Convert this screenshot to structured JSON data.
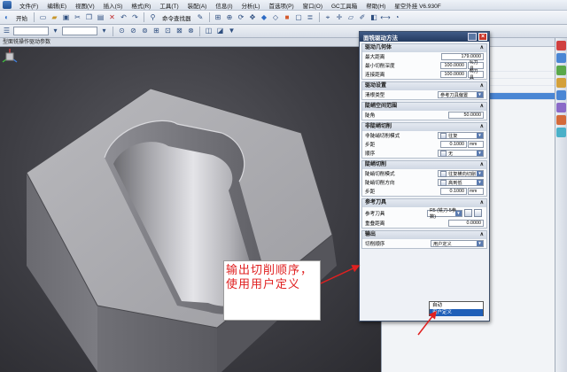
{
  "menubar": {
    "items": [
      "文件(F)",
      "编辑(E)",
      "视图(V)",
      "插入(S)",
      "格式(R)",
      "工具(T)",
      "装配(A)",
      "信息(I)",
      "分析(L)",
      "首选项(P)",
      "窗口(O)",
      "GC工具箱",
      "帮助(H)",
      "星空外挂 V6.930F"
    ]
  },
  "toolbar": {
    "start_label": "开始",
    "command_finder": "命令查找器"
  },
  "viewport": {
    "caption": "型面铣操作驱动参数"
  },
  "dialog": {
    "title": "面铣驱动方法",
    "sections": {
      "drive_geometry": {
        "title": "驱动几何体",
        "rows": [
          {
            "label": "最大距离",
            "value": "179.0000",
            "unit": ""
          },
          {
            "label": "最小切削深度",
            "value": "100.0000",
            "unit": "%刀具"
          },
          {
            "label": "连接距离",
            "value": "100.0000",
            "unit": "%刀具"
          }
        ]
      },
      "drive_settings": {
        "title": "驱动设置",
        "rows": [
          {
            "label": "清根类型",
            "value": "参考刀具偏置"
          }
        ]
      },
      "steep_space": {
        "title": "陡峭空间范围",
        "rows": [
          {
            "label": "陡角",
            "value": "50.0000"
          }
        ]
      },
      "non_steep": {
        "title": "非陡峭切削",
        "rows": [
          {
            "label": "非陡峭切削模式",
            "value": "往复"
          },
          {
            "label": "步距",
            "value": "0.1000",
            "unit": "mm"
          },
          {
            "label": "顺序",
            "value": "无"
          }
        ]
      },
      "steep": {
        "title": "陡峭切削",
        "rows": [
          {
            "label": "陡峭切削模式",
            "value": "往复横向切削"
          },
          {
            "label": "陡峭切削方向",
            "value": "高到低"
          },
          {
            "label": "步距",
            "value": "0.1000",
            "unit": "mm"
          }
        ]
      },
      "ref_tool": {
        "title": "参考刀具",
        "rows": [
          {
            "label": "参考刀具",
            "value": "R5 (铣刀-5参数)"
          },
          {
            "label": "重叠距离",
            "value": "0.0000"
          }
        ]
      },
      "output": {
        "title": "输出",
        "rows": [
          {
            "label": "切削顺序",
            "value": "用户定义"
          }
        ]
      }
    },
    "dropdown_options": [
      "自动",
      "用户定义"
    ]
  },
  "annotation": {
    "text": "输出切削顺序，使用用户定义"
  },
  "colors": {
    "dialog_title": "#2d4670",
    "annotation_text": "#e02020",
    "selection": "#1f5fb8"
  }
}
